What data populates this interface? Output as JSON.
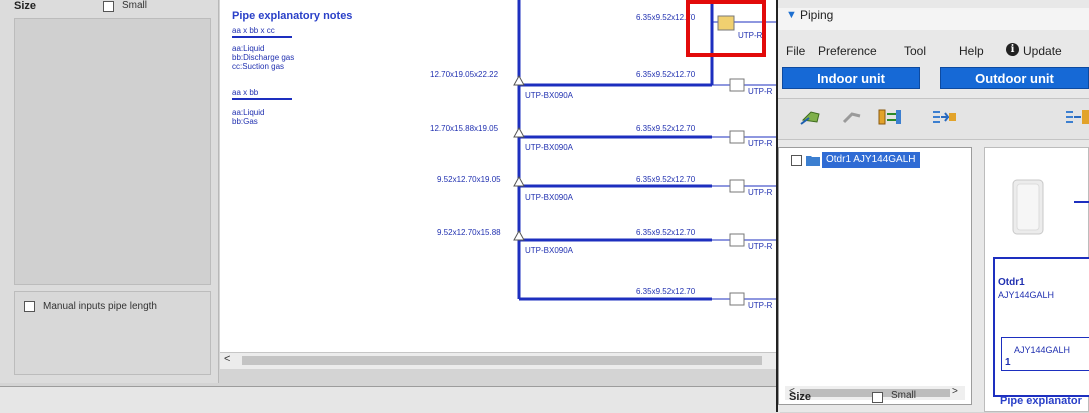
{
  "back_window": {
    "size_label": "Size",
    "small_label": "Small",
    "manual_label": "Manual inputs pipe length",
    "scroll_left": "<",
    "notes": {
      "title": "Pipe explanatory notes",
      "format1": "aa x bb x cc",
      "lines1": [
        "aa:Liquid",
        "bb:Discharge gas",
        "cc:Suction gas"
      ],
      "format2": "aa x bb",
      "lines2": [
        "aa:Liquid",
        "bb:Gas"
      ]
    },
    "diagram": {
      "main_sizes": [
        "12.70x19.05x22.22",
        "12.70x15.88x19.05",
        "9.52x12.70x19.05",
        "9.52x12.70x15.88"
      ],
      "branch_size": "6.35x9.52x12.70",
      "branch_label": "UTP-BX090A",
      "end_label": "UTP-R"
    }
  },
  "piping_window": {
    "title": "Piping",
    "menu": [
      "File",
      "Preference",
      "Tool",
      "Help",
      "Update"
    ],
    "info_icon": "i",
    "tabs": [
      "Indoor unit",
      "Outdoor unit"
    ],
    "tree_item": "Otdr1 AJY144GALH",
    "scroll_left": "<",
    "scroll_right": ">",
    "size_label": "Size",
    "small_label": "Small",
    "outdoor": {
      "name": "Otdr1",
      "model": "AJY144GALH",
      "inner_model": "AJY144GALH",
      "number": "1"
    },
    "notes_title": "Pipe explanator"
  },
  "colors": {
    "pipe": "#1d2fbf",
    "tab_blue": "#1669d6",
    "highlight": "#e20a0a"
  }
}
